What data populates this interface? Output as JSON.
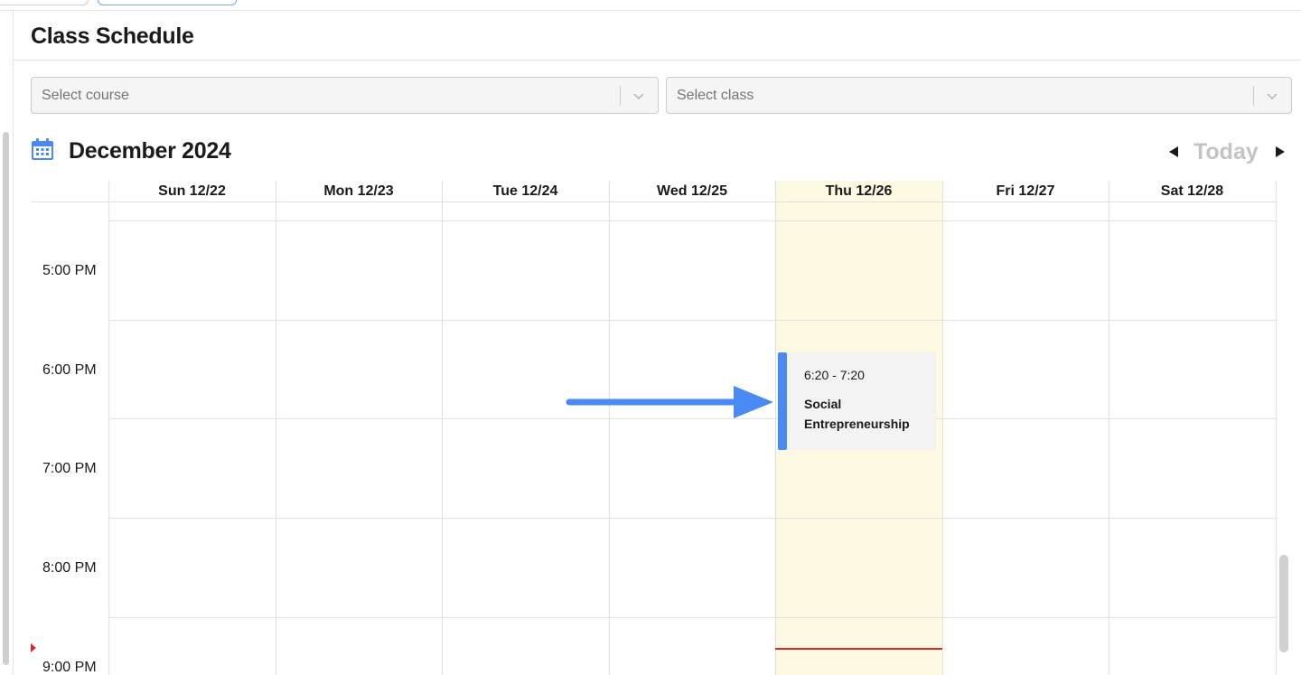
{
  "header": {
    "title": "Class Schedule"
  },
  "filters": {
    "course_placeholder": "Select course",
    "class_placeholder": "Select class"
  },
  "calendar": {
    "month_title": "December 2024",
    "today_label": "Today",
    "icons": {
      "calendar": "calendar-icon",
      "prev": "triangle-left-icon",
      "next": "triangle-right-icon"
    },
    "days": [
      "Sun 12/22",
      "Mon 12/23",
      "Tue 12/24",
      "Wed 12/25",
      "Thu 12/26",
      "Fri 12/27",
      "Sat 12/28"
    ],
    "highlighted_day": "Thu 12/26",
    "time_slots": [
      "5:00 PM",
      "6:00 PM",
      "7:00 PM",
      "8:00 PM",
      "9:00 PM"
    ],
    "events": [
      {
        "day": "Thu 12/26",
        "time": "6:20 - 7:20",
        "title": "Social Entrepreneurship"
      }
    ]
  },
  "colors": {
    "event_accent": "#4a8af4",
    "today_column": "#fdf9e3",
    "now_indicator": "#d82a2a",
    "annotation_arrow": "#4a8af4"
  }
}
